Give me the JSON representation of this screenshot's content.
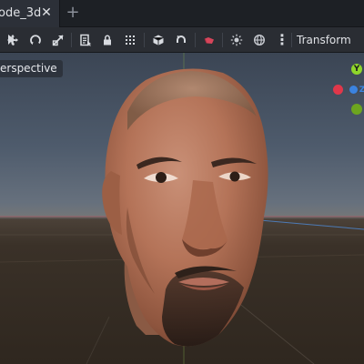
{
  "tabs": {
    "active_label": "ode_3d",
    "close_icon": "close-icon",
    "add_icon": "plus-icon"
  },
  "toolbar": {
    "tools": [
      {
        "icon": "select-icon"
      },
      {
        "icon": "move-icon"
      },
      {
        "icon": "rotate-icon"
      },
      {
        "icon": "scale-icon"
      },
      {
        "icon": "list-select-icon"
      },
      {
        "icon": "lock-icon"
      },
      {
        "icon": "snap-grid-icon"
      },
      {
        "icon": "local-space-icon"
      },
      {
        "icon": "snap-icon"
      },
      {
        "icon": "camera-icon"
      },
      {
        "icon": "sun-icon"
      },
      {
        "icon": "environment-icon"
      }
    ],
    "more_icon": "more-vertical-icon",
    "transform_menu": "Transform"
  },
  "viewport": {
    "view_label": "erspective",
    "gizmo": {
      "y_label": "Y",
      "z_label": "Z",
      "colors": {
        "x": "#e0374a",
        "y": "#8fd62a",
        "z": "#3b83e0"
      }
    },
    "model": "3d-head-scan"
  }
}
